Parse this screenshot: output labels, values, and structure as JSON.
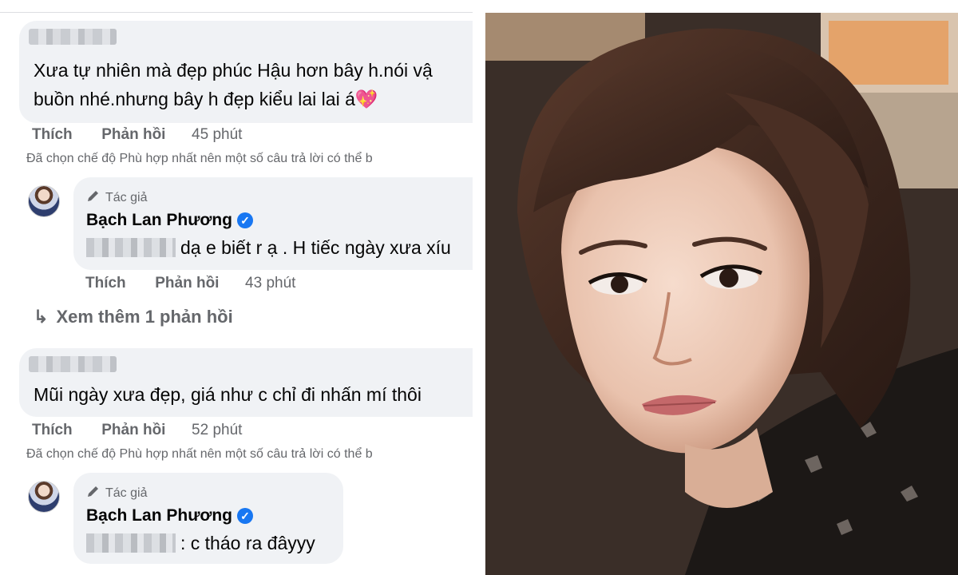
{
  "comments": [
    {
      "text_lines": [
        "Xưa tự nhiên mà đẹp phúc Hậu hơn bây h.nói vậ",
        "buồn nhé.nhưng bây h đẹp kiểu lai lai á💖"
      ],
      "actions": {
        "like": "Thích",
        "reply": "Phản hồi",
        "time": "45 phút"
      },
      "notice": "Đã chọn chế độ Phù hợp nhất nên một số câu trả lời có thể b",
      "reply": {
        "author_tag": "Tác giả",
        "author_name": "Bạch Lan Phương",
        "text": "dạ e biết r ạ . H tiếc ngày xưa xíu",
        "actions": {
          "like": "Thích",
          "reply": "Phản hồi",
          "time": "43 phút"
        }
      },
      "see_more": "Xem thêm 1 phản hồi"
    },
    {
      "text_lines": [
        "Mũi ngày xưa đẹp, giá như c chỉ đi nhấn mí thôi"
      ],
      "actions": {
        "like": "Thích",
        "reply": "Phản hồi",
        "time": "52 phút"
      },
      "notice": "Đã chọn chế độ Phù hợp nhất nên một số câu trả lời có thể b",
      "reply": {
        "author_tag": "Tác giả",
        "author_name": "Bạch Lan Phương",
        "text": ": c tháo ra đâyyy"
      }
    }
  ],
  "icons": {
    "author": "pencil-icon",
    "verified": "verified-badge-icon",
    "reply_arrow": "reply-arrow-icon"
  },
  "colors": {
    "bubble": "#f0f2f5",
    "secondary_text": "#65676b",
    "verified": "#1877f2"
  }
}
